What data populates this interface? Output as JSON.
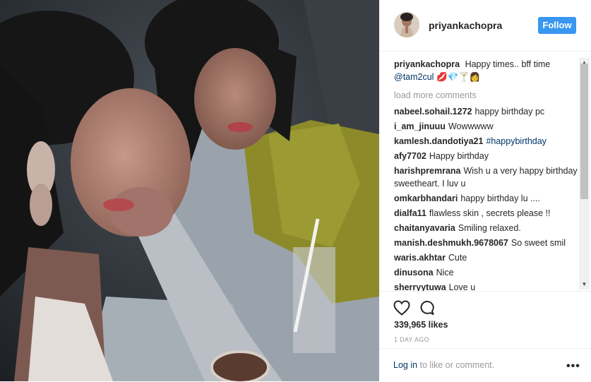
{
  "post": {
    "username": "priyankachopra",
    "follow_label": "Follow",
    "caption_user": "priyankachopra",
    "caption_text": "Happy times.. bff time",
    "caption_mention": "@tam2cul",
    "caption_emoji": "💋💎🍸👩",
    "load_more": "load more comments",
    "likes": "339,965 likes",
    "date": "1 DAY AGO",
    "login_link": "Log in",
    "login_rest": " to like or comment.",
    "more_glyph": "•••"
  },
  "comments": [
    {
      "user": "nabeel.sohail.1272",
      "text": "happy birthday pc"
    },
    {
      "user": "i_am_jinuuu",
      "text": "Wowwwww"
    },
    {
      "user": "kamlesh.dandotiya21",
      "text": "#happybirthday",
      "is_tag": true
    },
    {
      "user": "afy7702",
      "text": "Happy birthday"
    },
    {
      "user": "harishpremrana",
      "text": "Wish u a very happy birthday sweetheart. I luv u"
    },
    {
      "user": "omkarbhandari",
      "text": "happy birthday lu ...."
    },
    {
      "user": "dialfa11",
      "text": "flawless skin , secrets please !!"
    },
    {
      "user": "chaitanyavaria",
      "text": "Smiling relaxed."
    },
    {
      "user": "manish.deshmukh.9678067",
      "text": "So sweet smil"
    },
    {
      "user": "waris.akhtar",
      "text": "Cute"
    },
    {
      "user": "dinusona",
      "text": "Nice"
    },
    {
      "user": "sherryytuwa",
      "text": "Love u"
    }
  ],
  "colors": {
    "follow_button": "#3897f0",
    "link": "#003569",
    "muted": "#999999"
  }
}
